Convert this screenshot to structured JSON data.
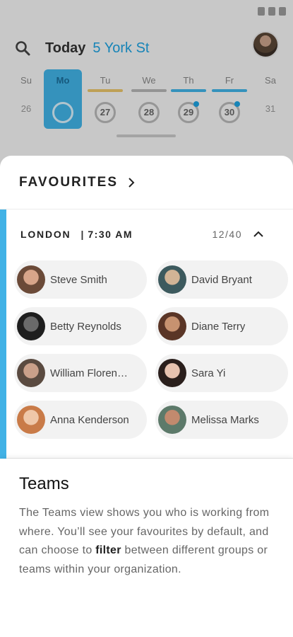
{
  "top_bar": {
    "today_label": "Today",
    "location_label": "5 York St"
  },
  "days": [
    {
      "name": "Su",
      "number": "26",
      "style": "plain"
    },
    {
      "name": "Mo",
      "number": "",
      "style": "selected"
    },
    {
      "name": "Tu",
      "number": "27",
      "style": "circle",
      "bar_color": "#e8c46a"
    },
    {
      "name": "We",
      "number": "28",
      "style": "circle",
      "bar_color": "#b5b5b5"
    },
    {
      "name": "Th",
      "number": "29",
      "style": "circle",
      "bar_color": "#41b2e6",
      "dot": true
    },
    {
      "name": "Fr",
      "number": "30",
      "style": "circle",
      "bar_color": "#41b2e6",
      "dot": true
    },
    {
      "name": "Sa",
      "number": "31",
      "style": "plain"
    }
  ],
  "favourites": {
    "title": "FAVOURITES"
  },
  "group": {
    "city": "LONDON",
    "separator": "|",
    "time": "7:30 AM",
    "count": "12/40",
    "accent_color": "#41b2e6"
  },
  "people": [
    {
      "name": "Steve Smith",
      "avatar_colors": [
        "#d8a58a",
        "#6b4a38"
      ]
    },
    {
      "name": "David Bryant",
      "avatar_colors": [
        "#d2b496",
        "#3d5a5e"
      ]
    },
    {
      "name": "Betty Reynolds",
      "avatar_colors": [
        "#6a6a6a",
        "#1e1e1e"
      ]
    },
    {
      "name": "Diane Terry",
      "avatar_colors": [
        "#c79270",
        "#5a3526"
      ]
    },
    {
      "name": "William Floren…",
      "avatar_colors": [
        "#caa08a",
        "#5a4a40"
      ]
    },
    {
      "name": "Sara Yi",
      "avatar_colors": [
        "#e7c3b0",
        "#2a1f1c"
      ]
    },
    {
      "name": "Anna Kenderson",
      "avatar_colors": [
        "#efc7a8",
        "#c97b48"
      ]
    },
    {
      "name": "Melissa Marks",
      "avatar_colors": [
        "#c28a6e",
        "#5d7a6a"
      ]
    }
  ],
  "info": {
    "title": "Teams",
    "body_before": "The Teams view shows you who is working from where. You’ll see your favourites by default, and can choose to ",
    "body_bold": "filter",
    "body_after": " between different groups or teams within your organization."
  }
}
